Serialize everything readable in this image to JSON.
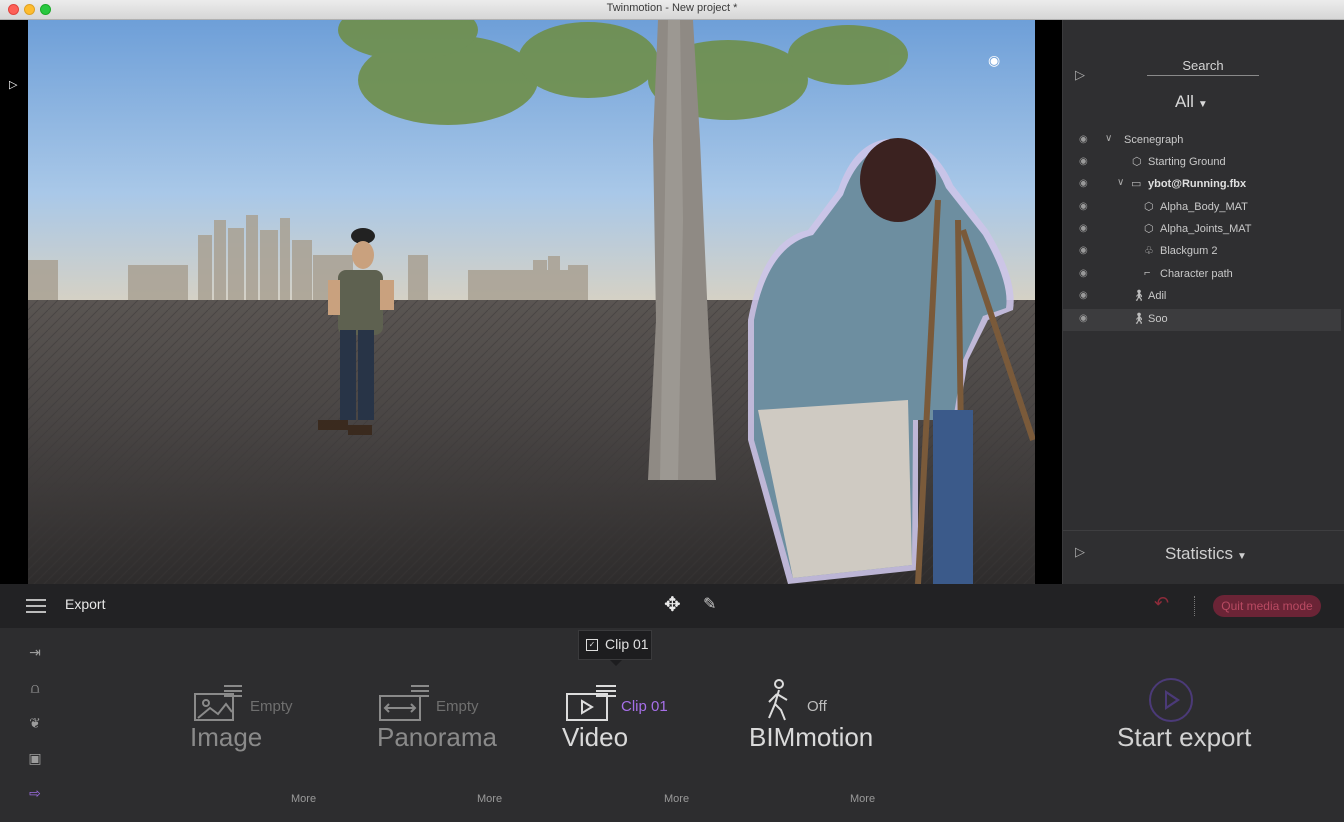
{
  "window": {
    "title": "Twinmotion - New project *"
  },
  "right_panel": {
    "search_label": "Search",
    "filter_label": "All",
    "tree": [
      {
        "label": "Scenegraph",
        "icon": "chevron-down-icon",
        "indent": 0
      },
      {
        "label": "Starting Ground",
        "icon": "cube-icon",
        "indent": 1
      },
      {
        "label": "ybot@Running.fbx",
        "icon": "folder-icon",
        "indent": 1
      },
      {
        "label": "Alpha_Body_MAT",
        "icon": "cube-icon",
        "indent": 2
      },
      {
        "label": "Alpha_Joints_MAT",
        "icon": "cube-icon",
        "indent": 2
      },
      {
        "label": "Blackgum 2",
        "icon": "tree-icon",
        "indent": 2
      },
      {
        "label": "Character path",
        "icon": "path-icon",
        "indent": 2
      },
      {
        "label": "Adil",
        "icon": "walker-icon",
        "indent": 1
      },
      {
        "label": "Soo",
        "icon": "walker-icon",
        "indent": 1
      }
    ],
    "statistics_label": "Statistics"
  },
  "toolbar": {
    "section_title": "Export",
    "quit_label": "Quit media mode"
  },
  "export": {
    "tooltip_label": "Clip 01",
    "modes": [
      {
        "name": "Image",
        "status": "Empty",
        "more": "More",
        "icon": "image-icon"
      },
      {
        "name": "Panorama",
        "status": "Empty",
        "more": "More",
        "icon": "panorama-icon"
      },
      {
        "name": "Video",
        "status": "Clip 01",
        "more": "More",
        "icon": "video-icon"
      },
      {
        "name": "BIMmotion",
        "status": "Off",
        "more": "More",
        "icon": "walker-icon"
      }
    ],
    "start_label": "Start export"
  },
  "colors": {
    "accent": "#a66fe8",
    "quit_bg": "#6b2436",
    "undo": "#8e2b3a"
  }
}
